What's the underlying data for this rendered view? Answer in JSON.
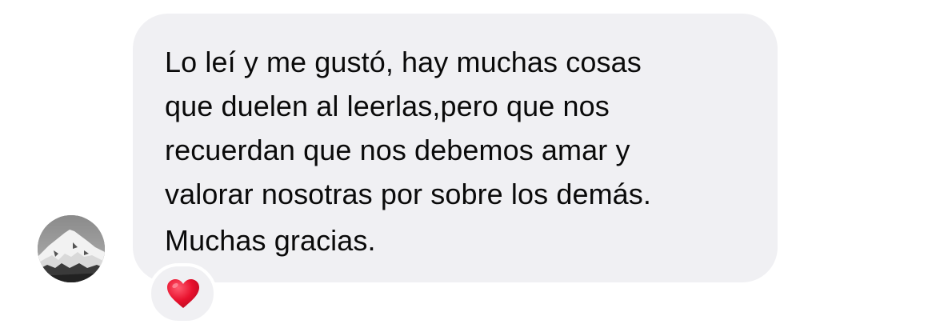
{
  "message": {
    "lines": [
      "Lo leí y me gustó, hay muchas cosas",
      "que duelen al leerlas,pero que nos",
      "recuerdan que nos debemos amar y",
      "valorar nosotras por sobre los demás.",
      "Muchas gracias."
    ]
  },
  "reaction": {
    "icon": "red-heart-icon",
    "color": "#e8112d"
  },
  "avatar": {
    "icon": "mountain-photo-avatar"
  },
  "colors": {
    "bubble": "#f0f0f3",
    "text": "#0a0a0a",
    "background": "#ffffff"
  }
}
